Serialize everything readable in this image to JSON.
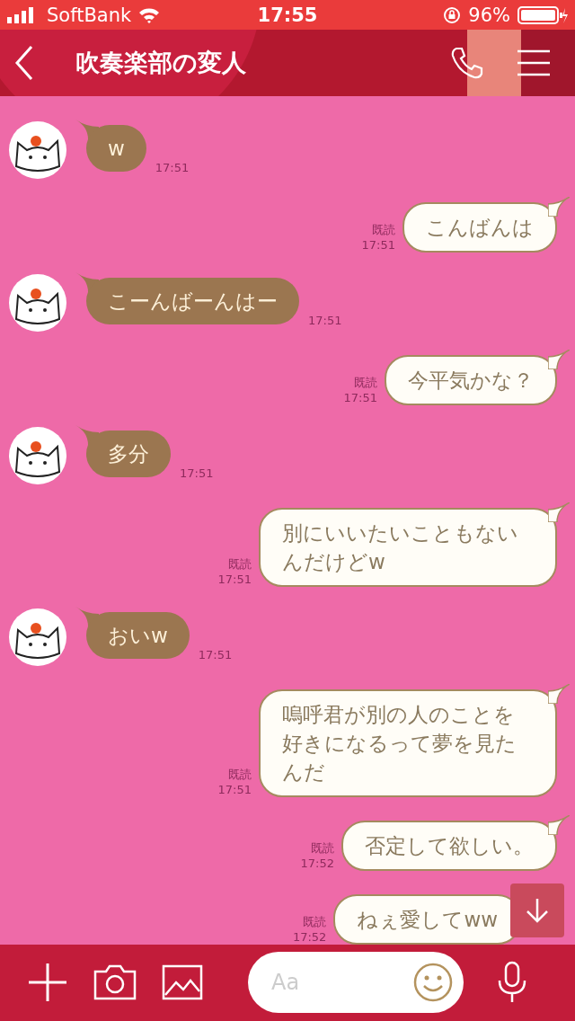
{
  "status_bar": {
    "carrier": "SoftBank",
    "time": "17:55",
    "battery": "96%"
  },
  "header": {
    "title": "吹奏楽部の変人"
  },
  "messages": [
    {
      "kind": "left",
      "text": "w",
      "time": "17:51"
    },
    {
      "kind": "right",
      "text": "こんばんは",
      "read": "既読",
      "time": "17:51"
    },
    {
      "kind": "left",
      "text": "こーんばーんはー",
      "time": "17:51"
    },
    {
      "kind": "right",
      "text": "今平気かな？",
      "read": "既読",
      "time": "17:51"
    },
    {
      "kind": "left",
      "text": "多分",
      "time": "17:51"
    },
    {
      "kind": "right",
      "text": "別にいいたいこともないんだけどw",
      "read": "既読",
      "time": "17:51"
    },
    {
      "kind": "left",
      "text": "おいw",
      "time": "17:51"
    },
    {
      "kind": "right",
      "text": "嗚呼君が別の人のことを好きになるって夢を見たんだ",
      "read": "既読",
      "time": "17:51"
    },
    {
      "kind": "right",
      "text": "否定して欲しい。",
      "read": "既読",
      "time": "17:52"
    },
    {
      "kind": "right",
      "text": "ねぇ愛してww",
      "read": "既読",
      "time": "17:52"
    }
  ],
  "composer": {
    "placeholder": "Aa"
  }
}
